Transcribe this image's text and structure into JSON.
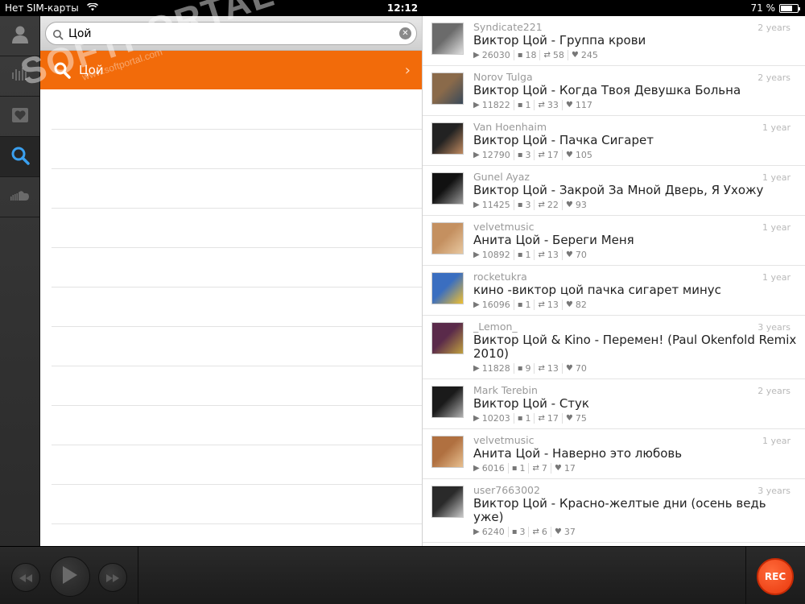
{
  "status": {
    "carrier": "Нет SIM-карты",
    "time": "12:12",
    "battery": "71 %",
    "battery_level": 0.71
  },
  "nav": [
    "user-icon",
    "stream-icon",
    "likes-icon",
    "search-icon",
    "soundcloud-icon"
  ],
  "search": {
    "query": "Цой",
    "suggestion": "Цой"
  },
  "tracks": [
    {
      "user": "Syndicate221",
      "age": "2 years",
      "title": "Виктор Цой - Группа крови",
      "plays": "26030",
      "comments": "18",
      "reposts": "58",
      "likes": "245",
      "art": [
        "#6b6b6b",
        "#e0e0e0"
      ]
    },
    {
      "user": "Norov Tulga",
      "age": "2 years",
      "title": "Виктор Цой - Когда Твоя Девушка Больна",
      "plays": "11822",
      "comments": "1",
      "reposts": "33",
      "likes": "117",
      "art": [
        "#8a6a4a",
        "#3a4a5a"
      ]
    },
    {
      "user": "Van Hoenhaim",
      "age": "1 year",
      "title": "Виктор Цой - Пачка Сигарет",
      "plays": "12790",
      "comments": "3",
      "reposts": "17",
      "likes": "105",
      "art": [
        "#222222",
        "#c08a60"
      ]
    },
    {
      "user": "Gunel Ayaz",
      "age": "1 year",
      "title": "Виктор Цой - Закрой За Мной Дверь, Я Ухожу",
      "plays": "11425",
      "comments": "3",
      "reposts": "22",
      "likes": "93",
      "art": [
        "#111111",
        "#999999"
      ]
    },
    {
      "user": "velvetmusic",
      "age": "1 year",
      "title": "Анита Цой - Береги Меня",
      "plays": "10892",
      "comments": "1",
      "reposts": "13",
      "likes": "70",
      "art": [
        "#c49060",
        "#e8c8a0"
      ]
    },
    {
      "user": "rocketukra",
      "age": "1 year",
      "title": "кино -виктор цой пачка сигарет минус",
      "plays": "16096",
      "comments": "1",
      "reposts": "13",
      "likes": "82",
      "art": [
        "#3a6ec0",
        "#f0c030"
      ]
    },
    {
      "user": "_Lemon_",
      "age": "3 years",
      "title": "Виктор Цой & Kino - Перемен! (Paul Okenfold Remix 2010)",
      "plays": "11828",
      "comments": "9",
      "reposts": "13",
      "likes": "70",
      "art": [
        "#5a2a4a",
        "#c0a040"
      ]
    },
    {
      "user": "Mark Terebin",
      "age": "2 years",
      "title": "Виктор Цой - Стук",
      "plays": "10203",
      "comments": "1",
      "reposts": "17",
      "likes": "75",
      "art": [
        "#1a1a1a",
        "#b0b0b0"
      ]
    },
    {
      "user": "velvetmusic",
      "age": "1 year",
      "title": "Анита Цой - Наверно это любовь",
      "plays": "6016",
      "comments": "1",
      "reposts": "7",
      "likes": "17",
      "art": [
        "#b07040",
        "#e8c090"
      ]
    },
    {
      "user": "user7663002",
      "age": "3 years",
      "title": "Виктор Цой - Красно-желтые дни (осень ведь уже)",
      "plays": "6240",
      "comments": "3",
      "reposts": "6",
      "likes": "37",
      "art": [
        "#2a2a2a",
        "#c8c8c8"
      ]
    }
  ],
  "player": {
    "rec_label": "REC"
  },
  "watermark": {
    "main": "SOFTPORTAL",
    "sub": "www.softportal.com"
  },
  "colors": {
    "accent": "#f26b0a",
    "rec": "#e8370c"
  }
}
